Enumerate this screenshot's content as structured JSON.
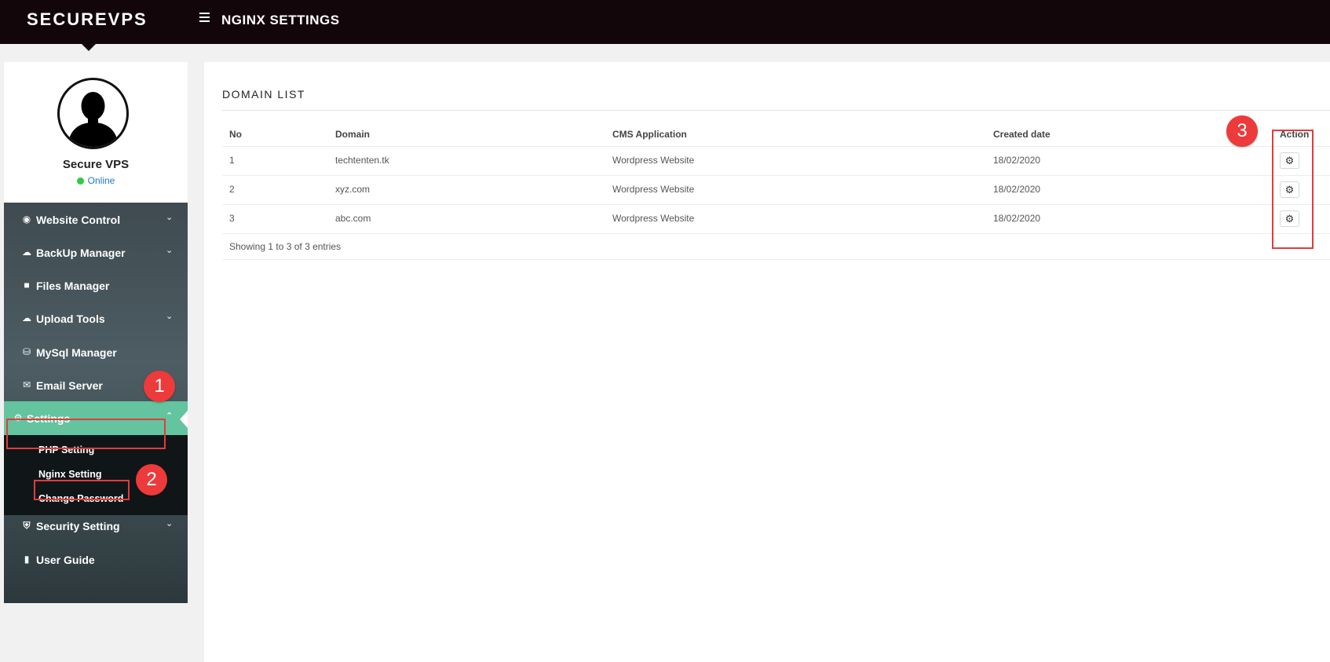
{
  "app": {
    "brand": "SECUREVPS",
    "page_title": "NGINX SETTINGS"
  },
  "profile": {
    "name": "Secure VPS",
    "status": "Online"
  },
  "sidebar": {
    "items": [
      {
        "label": "Website Control",
        "icon": "globe-icon"
      },
      {
        "label": "BackUp Manager",
        "icon": "cloud-icon"
      },
      {
        "label": "Files Manager",
        "icon": "folder-icon"
      },
      {
        "label": "Upload Tools",
        "icon": "cloud-upload-icon"
      },
      {
        "label": "MySql Manager",
        "icon": "database-icon"
      },
      {
        "label": "Email Server",
        "icon": "envelope-icon"
      },
      {
        "label": "Settings",
        "icon": "gears-icon"
      },
      {
        "label": "Security Setting",
        "icon": "shield-icon"
      },
      {
        "label": "User Guide",
        "icon": "book-icon"
      }
    ],
    "submenu": [
      {
        "label": "PHP Setting"
      },
      {
        "label": "Nginx Setting"
      },
      {
        "label": "Change Password"
      }
    ]
  },
  "annotations": [
    "1",
    "2",
    "3"
  ],
  "domain_list": {
    "title": "DOMAIN LIST",
    "columns": [
      "No",
      "Domain",
      "CMS Application",
      "Created date",
      "Action"
    ],
    "rows": [
      {
        "no": "1",
        "domain": "techtenten.tk",
        "cms": "Wordpress Website",
        "created": "18/02/2020"
      },
      {
        "no": "2",
        "domain": "xyz.com",
        "cms": "Wordpress Website",
        "created": "18/02/2020"
      },
      {
        "no": "3",
        "domain": "abc.com",
        "cms": "Wordpress Website",
        "created": "18/02/2020"
      }
    ],
    "info": "Showing 1 to 3 of 3 entries"
  },
  "colors": {
    "topbar": "#13060b",
    "active": "#63c49f",
    "annotation": "#ed3a3a"
  }
}
